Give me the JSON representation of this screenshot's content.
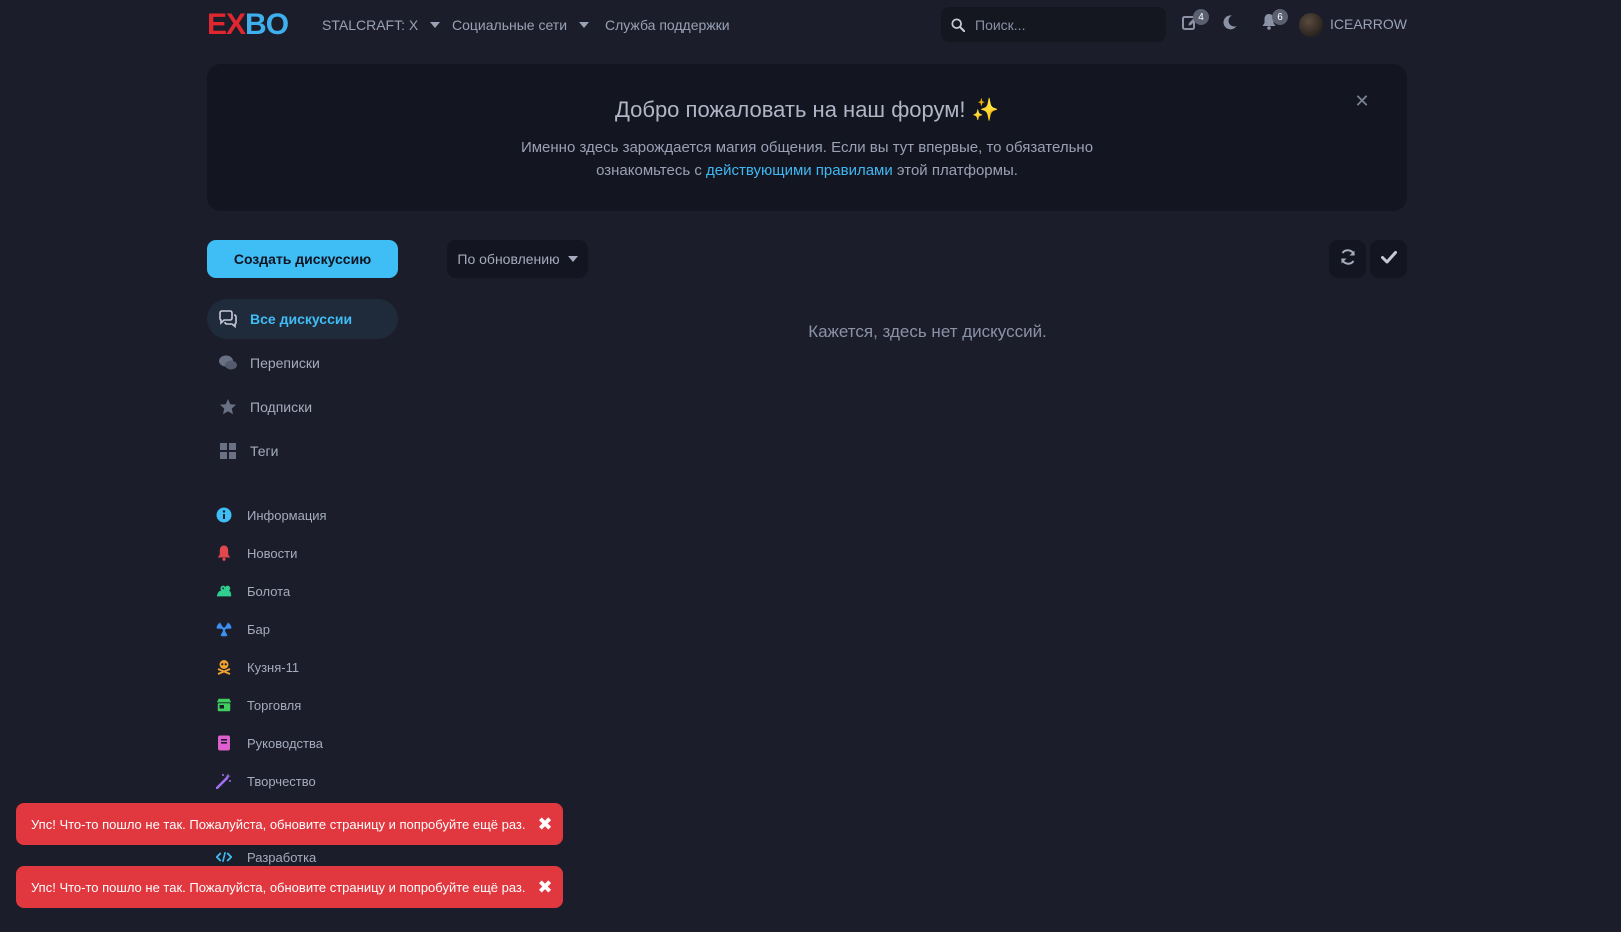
{
  "header": {
    "logo_left": "EX",
    "logo_right": "BO",
    "nav": [
      {
        "label": "STALCRAFT: X",
        "has_dropdown": true
      },
      {
        "label": "Социальные сети",
        "has_dropdown": true
      },
      {
        "label": "Служба поддержки",
        "has_dropdown": false
      }
    ],
    "search_placeholder": "Поиск...",
    "drafts_badge": "4",
    "notifications_badge": "6",
    "username": "ICEARROW"
  },
  "hero": {
    "title": "Добро пожаловать на наш форум! ✨",
    "text_before": "Именно здесь зарождается магия общения. Если вы тут впервые, то обязательно ознакомьтесь с ",
    "link": "действующими правилами",
    "text_after": " этой платформы.",
    "close_glyph": "✕"
  },
  "toolbar": {
    "create_label": "Создать дискуссию",
    "sort_label": "По обновлению"
  },
  "empty_message": "Кажется, здесь нет дискуссий.",
  "sidebar": {
    "nav": [
      {
        "label": "Все дискуссии",
        "icon": "comments-icon",
        "active": true
      },
      {
        "label": "Переписки",
        "icon": "chat-bubbles-icon",
        "active": false
      },
      {
        "label": "Подписки",
        "icon": "star-icon",
        "active": false
      },
      {
        "label": "Теги",
        "icon": "grid-icon",
        "active": false
      }
    ],
    "tags": [
      {
        "label": "Информация",
        "icon": "info-icon",
        "color": "#3fbdf5"
      },
      {
        "label": "Новости",
        "icon": "bell-icon",
        "color": "#e0474f"
      },
      {
        "label": "Болота",
        "icon": "frog-icon",
        "color": "#2fcf8f"
      },
      {
        "label": "Бар",
        "icon": "radiation-icon",
        "color": "#3b8ff0"
      },
      {
        "label": "Кузня-11",
        "icon": "skull-crossbones-icon",
        "color": "#f0a030"
      },
      {
        "label": "Торговля",
        "icon": "store-icon",
        "color": "#3fcf5f"
      },
      {
        "label": "Руководства",
        "icon": "book-icon",
        "color": "#e05fcf"
      },
      {
        "label": "Творчество",
        "icon": "magic-wand-icon",
        "color": "#a06ff0"
      },
      {
        "label": "Разработка",
        "icon": "code-icon",
        "color": "#3fbdf5"
      }
    ]
  },
  "toasts": [
    {
      "message": "Упс! Что-то пошло не так. Пожалуйста, обновите страницу и попробуйте ещё раз.",
      "close_glyph": "✖"
    },
    {
      "message": "Упс! Что-то пошло не так. Пожалуйста, обновите страницу и попробуйте ещё раз.",
      "close_glyph": "✖"
    }
  ],
  "colors": {
    "background": "#1b1e2a",
    "accent": "#3fbdf5",
    "error": "#e1373f"
  }
}
